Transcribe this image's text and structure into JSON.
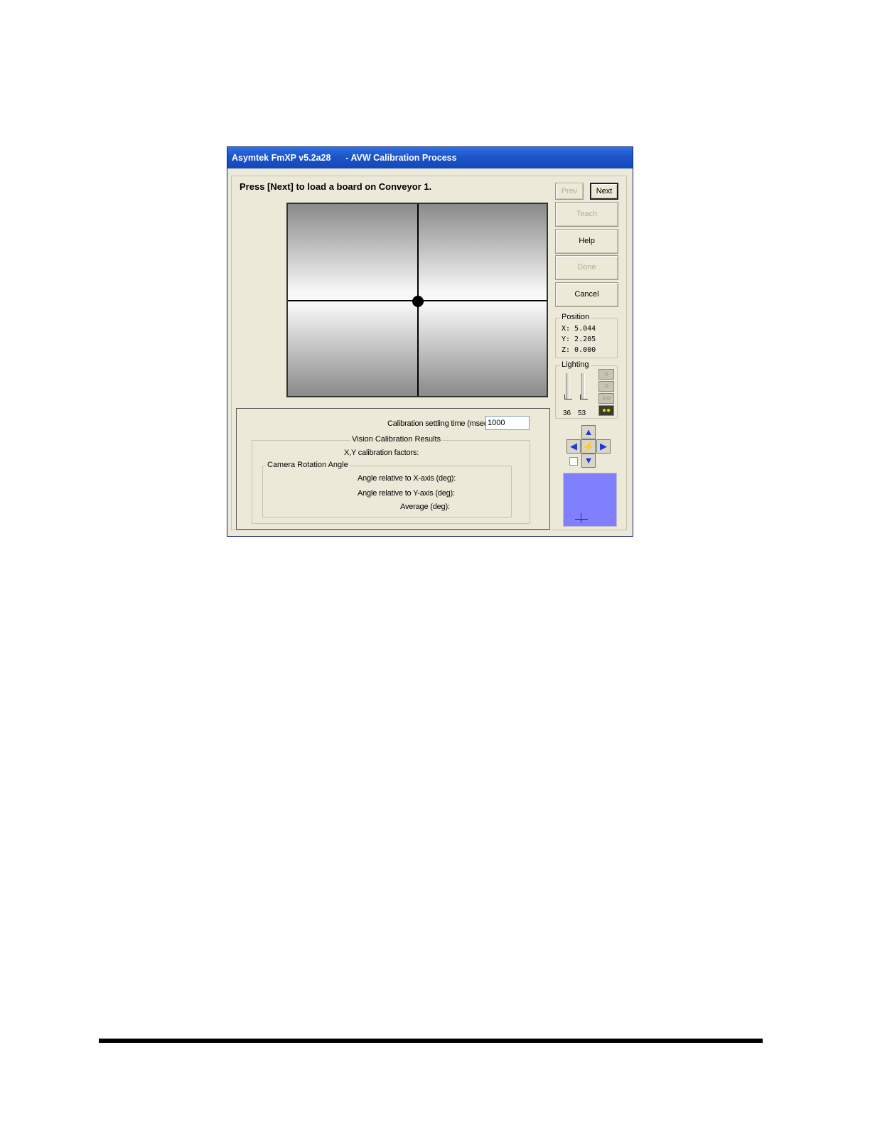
{
  "window": {
    "title": "Asymtek FmXP v5.2a28      - AVW Calibration Process"
  },
  "instruction": "Press [Next] to load a board on Conveyor 1.",
  "buttons": {
    "prev": "Prev",
    "next": "Next",
    "teach": "Teach",
    "help": "Help",
    "done": "Done",
    "cancel": "Cancel"
  },
  "position": {
    "title": "Position",
    "x_label": "X:",
    "x_value": "5.044",
    "y_label": "Y:",
    "y_value": "2.205",
    "z_label": "Z:",
    "z_value": "0.000"
  },
  "lighting": {
    "title": "Lighting",
    "slider1_value": "36",
    "slider2_value": "53",
    "bulb_icons": [
      "bulb-icon",
      "bulb-icon",
      "double-bulb-icon",
      "double-bulb-lit-icon"
    ]
  },
  "jog": {
    "icons": [
      "arrow-up-icon",
      "arrow-left-icon",
      "lightning-icon",
      "arrow-right-icon",
      "arrow-down-icon"
    ]
  },
  "calibration": {
    "settling_label": "Calibration settling time (msec):",
    "settling_value": "1000",
    "results_title": "Vision Calibration Results",
    "xy_factors_label": "X,Y calibration factors:",
    "rotation_title": "Camera Rotation Angle",
    "angle_x_label": "Angle relative to X-axis (deg):",
    "angle_y_label": "Angle relative to Y-axis (deg):",
    "average_label": "Average (deg):"
  },
  "colors": {
    "title_bar": "#1d54c8",
    "dialog_bg": "#ece9d8",
    "preview_bg": "#8080ff",
    "arrow": "#1b3bd6"
  }
}
